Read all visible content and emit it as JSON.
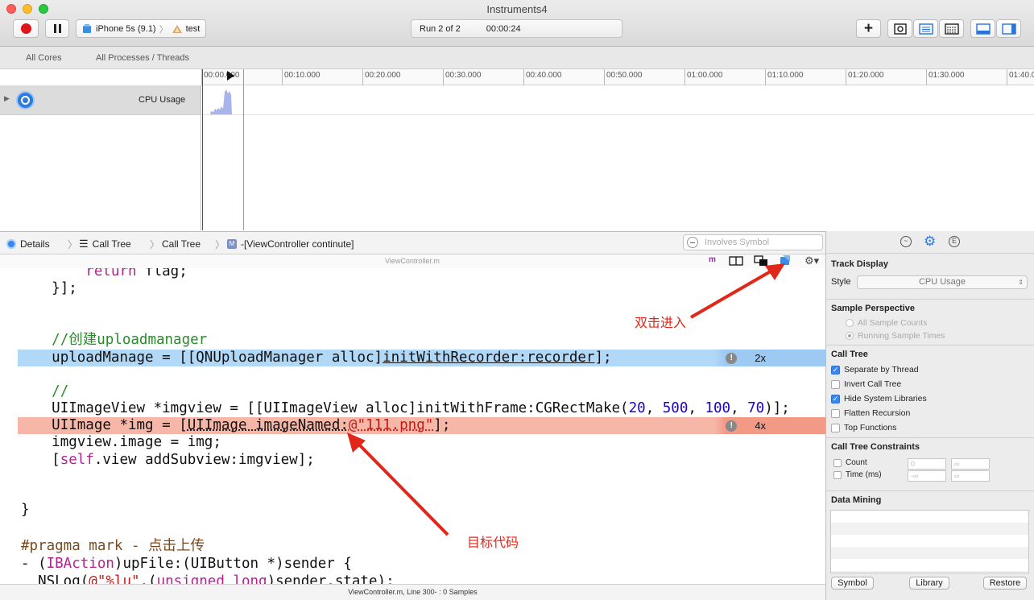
{
  "window": {
    "title": "Instruments4"
  },
  "toolbar": {
    "device": "iPhone 5s (9.1)",
    "target": "test",
    "run_label": "Run 2 of 2",
    "run_time": "00:00:24",
    "add_label": "+"
  },
  "scope": {
    "cores": "All Cores",
    "processes": "All Processes / Threads"
  },
  "ruler": {
    "ticks": [
      "00:00.000",
      "00:10.000",
      "00:20.000",
      "00:30.000",
      "00:40.000",
      "00:50.000",
      "01:00.000",
      "01:10.000",
      "01:20.000",
      "01:30.000",
      "01:40.0"
    ]
  },
  "track": {
    "name": "CPU Usage"
  },
  "jumpbar": {
    "details": "Details",
    "crumb1": "Call Tree",
    "crumb2": "Call Tree",
    "method_badge": "M",
    "method": "-[ViewController continute]",
    "search_placeholder": "Involves Symbol"
  },
  "editor": {
    "filename": "ViewController.m",
    "file_badge": "m",
    "annotations": {
      "line1_count": "2x",
      "line2_count": "4x"
    },
    "lines": {
      "l1_kw": "return",
      "l1_rest": " flag;",
      "l2": "}];",
      "l3": "//创建uploadmanager",
      "l4_pre": "uploadManage = [[QNUploadManager alloc]",
      "l4_mid": "initWithRecorder:recorder",
      "l4_post": "];",
      "l5": "//",
      "l6_pre": "UIImageView *imgview = [[UIImageView alloc]initWithFrame:CGRectMake(",
      "l6_n1": "20",
      "l6_s1": ", ",
      "l6_n2": "500",
      "l6_s2": ", ",
      "l6_n3": "100",
      "l6_s3": ", ",
      "l6_n4": "70",
      "l6_post": ")];",
      "l7_pre": "UIImage *img = [",
      "l7_mid": "UIImage imageNamed:",
      "l7_str": "@\"111.png\"",
      "l7_post": "];",
      "l8": "imgview.image = img;",
      "l9_a": "[",
      "l9_kw": "self",
      "l9_b": ".view addSubview:imgview];",
      "l10": "}",
      "l11": "#pragma mark - 点击上传",
      "l12_a": "- (",
      "l12_kw": "IBAction",
      "l12_b": ")upFile:(UIButton *)sender {",
      "l13_a": "NSLog(",
      "l13_str": "@\"%lu\"",
      "l13_b": ",(",
      "l13_kw": "unsigned long",
      "l13_c": ")sender.state);"
    }
  },
  "status": {
    "text": "ViewController.m, Line 300- : 0 Samples"
  },
  "inspector": {
    "track_display": "Track Display",
    "style_label": "Style",
    "style_value": "CPU Usage",
    "sample_perspective": "Sample Perspective",
    "all_sample_counts": "All Sample Counts",
    "running_sample_times": "Running Sample Times",
    "call_tree": "Call Tree",
    "separate_by_thread": "Separate by Thread",
    "invert_call_tree": "Invert Call Tree",
    "hide_system_libraries": "Hide System Libraries",
    "flatten_recursion": "Flatten Recursion",
    "top_functions": "Top Functions",
    "constraints": "Call Tree Constraints",
    "count": "Count",
    "time_ms": "Time (ms)",
    "count_min": "0",
    "count_max": "∞",
    "time_min": "-∞",
    "time_max": "∞",
    "data_mining": "Data Mining",
    "symbol_btn": "Symbol",
    "library_btn": "Library",
    "restore_btn": "Restore"
  },
  "annotations": {
    "double_click": "双击进入",
    "target_code": "目标代码"
  }
}
